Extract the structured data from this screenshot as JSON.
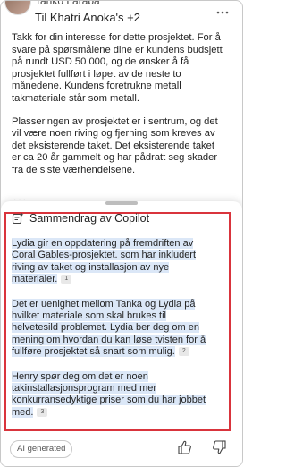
{
  "header": {
    "sender": "Tariko Laraba",
    "recipients": "Til Khatri Anoka's +2"
  },
  "email": {
    "paragraph1": "Takk for din interesse for dette prosjektet. For å svare på spørsmålene dine er kundens budsjett på rundt USD 50 000, og de ønsker å få prosjektet fullført i løpet av de neste to månedene. Kundens foretrukne metall takmateriale står som metall.",
    "paragraph2": "Plasseringen av prosjektet er i sentrum, og det vil være noen riving og fjerning som kreves av det eksisterende taket. Det eksisterende taket er ca 20 år gammelt og har pådratt seg skader fra de siste værhendelsene."
  },
  "copilot": {
    "title": "Sammendrag av Copilot",
    "items": [
      {
        "text": "Lydia gir en oppdatering på fremdriften av Coral Gables-prosjektet. som har inkludert riving av taket og installasjon av nye materialer.",
        "cite": "1"
      },
      {
        "text": "Det er uenighet mellom Tanka og Lydia på hvilket materiale som skal brukes til helvetesild problemet. Lydia ber deg om en mening om hvordan du kan løse tvisten for å fullføre prosjektet så snart som mulig.",
        "cite": "2"
      },
      {
        "text": "Henry spør deg om det er noen takinstallasjonsprogram med mer konkurransedyktige priser som du har jobbet med.",
        "cite": "3"
      }
    ]
  },
  "footer": {
    "ai_label": "AI generated"
  },
  "icons": {
    "more": "more-icon",
    "copilot": "copilot-sparkle-icon",
    "like": "thumbs-up-icon",
    "dislike": "thumbs-down-icon"
  },
  "colors": {
    "highlight": "#dbe7f7",
    "annotation_box": "#d9343c"
  }
}
